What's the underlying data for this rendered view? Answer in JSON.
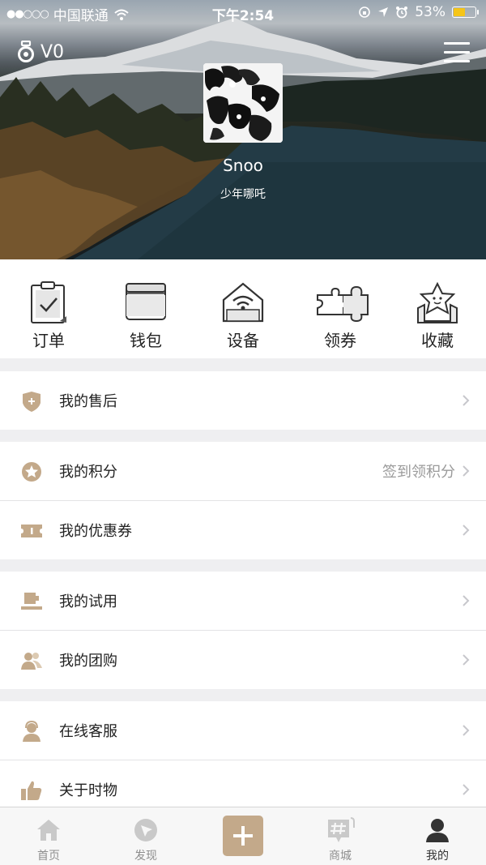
{
  "status_bar": {
    "carrier": "中国联通",
    "time": "下午2:54",
    "battery_percent": "53%",
    "battery_level": 0.53
  },
  "profile": {
    "level": "V0",
    "name": "Snoo",
    "signature": "少年哪吒"
  },
  "quick_actions": [
    {
      "label": "订单",
      "icon": "order-clipboard-icon"
    },
    {
      "label": "钱包",
      "icon": "wallet-icon"
    },
    {
      "label": "设备",
      "icon": "device-wifi-icon"
    },
    {
      "label": "领券",
      "icon": "puzzle-coupon-icon"
    },
    {
      "label": "收藏",
      "icon": "star-box-icon"
    }
  ],
  "menu": {
    "after_sales": {
      "label": "我的售后",
      "icon": "shield-plus-icon"
    },
    "points": {
      "label": "我的积分",
      "value": "签到领积分",
      "icon": "star-circle-icon"
    },
    "coupons": {
      "label": "我的优惠券",
      "icon": "ticket-icon"
    },
    "trial": {
      "label": "我的试用",
      "icon": "trial-product-icon"
    },
    "group_buy": {
      "label": "我的团购",
      "icon": "group-users-icon"
    },
    "service": {
      "label": "在线客服",
      "icon": "support-agent-icon"
    },
    "about": {
      "label": "关于时物",
      "icon": "thumbs-up-icon"
    }
  },
  "tabs": [
    {
      "label": "首页",
      "icon": "home-icon"
    },
    {
      "label": "发现",
      "icon": "discover-icon"
    },
    {
      "label": "",
      "icon": "plus-icon"
    },
    {
      "label": "商城",
      "icon": "shop-hash-icon"
    },
    {
      "label": "我的",
      "icon": "profile-icon",
      "active": true
    }
  ],
  "colors": {
    "accent": "#c3a98a",
    "battery": "#f5c518",
    "icon_gray": "#bdbdbd"
  }
}
